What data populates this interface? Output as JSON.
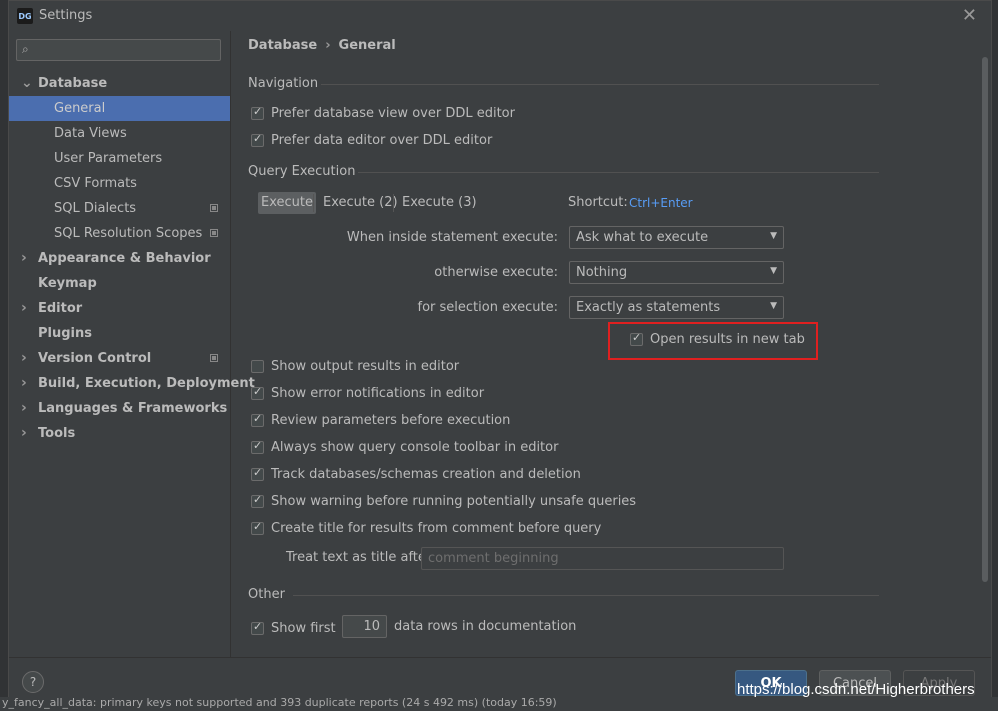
{
  "window": {
    "title": "Settings",
    "logo_text": "DG"
  },
  "search": {
    "placeholder": "",
    "value": ""
  },
  "sidebar": {
    "items": [
      {
        "label": "Database",
        "level": 0,
        "expanded": true
      },
      {
        "label": "General",
        "level": 1,
        "selected": true
      },
      {
        "label": "Data Views",
        "level": 1
      },
      {
        "label": "User Parameters",
        "level": 1
      },
      {
        "label": "CSV Formats",
        "level": 1
      },
      {
        "label": "SQL Dialects",
        "level": 1
      },
      {
        "label": "SQL Resolution Scopes",
        "level": 1
      },
      {
        "label": "Appearance & Behavior",
        "level": 0
      },
      {
        "label": "Keymap",
        "level": 0
      },
      {
        "label": "Editor",
        "level": 0
      },
      {
        "label": "Plugins",
        "level": 0
      },
      {
        "label": "Version Control",
        "level": 0
      },
      {
        "label": "Build, Execution, Deployment",
        "level": 0
      },
      {
        "label": "Languages & Frameworks",
        "level": 0
      },
      {
        "label": "Tools",
        "level": 0
      }
    ]
  },
  "breadcrumb": {
    "parent": "Database",
    "separator": "›",
    "current": "General"
  },
  "navigation": {
    "title": "Navigation",
    "options": [
      {
        "label": "Prefer database view over DDL editor",
        "checked": true
      },
      {
        "label": "Prefer data editor over DDL editor",
        "checked": true
      }
    ]
  },
  "query_execution": {
    "title": "Query Execution",
    "tabs": [
      {
        "label": "Execute",
        "active": true
      },
      {
        "label": "Execute (2)"
      },
      {
        "label": "Execute (3)"
      }
    ],
    "shortcut_label": "Shortcut:",
    "shortcut_value": "Ctrl+Enter",
    "rows": [
      {
        "label": "When inside statement execute:",
        "value": "Ask what to execute"
      },
      {
        "label": "otherwise execute:",
        "value": "Nothing"
      },
      {
        "label": "for selection execute:",
        "value": "Exactly as statements"
      }
    ],
    "open_results_new_tab": {
      "label": "Open results in new tab",
      "checked": true
    },
    "options": [
      {
        "label": "Show output results in editor",
        "checked": false
      },
      {
        "label": "Show error notifications in editor",
        "checked": true
      },
      {
        "label": "Review parameters before execution",
        "checked": true
      },
      {
        "label": "Always show query console toolbar in editor",
        "checked": true
      },
      {
        "label": "Track databases/schemas creation and deletion",
        "checked": true
      },
      {
        "label": "Show warning before running potentially unsafe queries",
        "checked": true
      },
      {
        "label": "Create title for results from comment before query",
        "checked": true
      }
    ],
    "title_field_label": "Treat text as title after",
    "title_field_value": "comment beginning"
  },
  "other": {
    "title": "Other",
    "show_first_label": "Show first",
    "show_first_value": "10",
    "show_first_suffix": "data rows in documentation"
  },
  "footer": {
    "help": "?",
    "ok": "OK",
    "cancel": "Cancel",
    "apply": "Apply"
  },
  "statusbar": {
    "message": "y_fancy_all_data: primary keys not supported and 393 duplicate reports (24 s 492 ms) (today 16:59)"
  },
  "watermark": "https://blog.csdn.net/Higherbrothers",
  "colors": {
    "accent": "#4b6eaf",
    "link": "#589df6",
    "primary_button": "#365880",
    "highlight": "#e02020"
  }
}
